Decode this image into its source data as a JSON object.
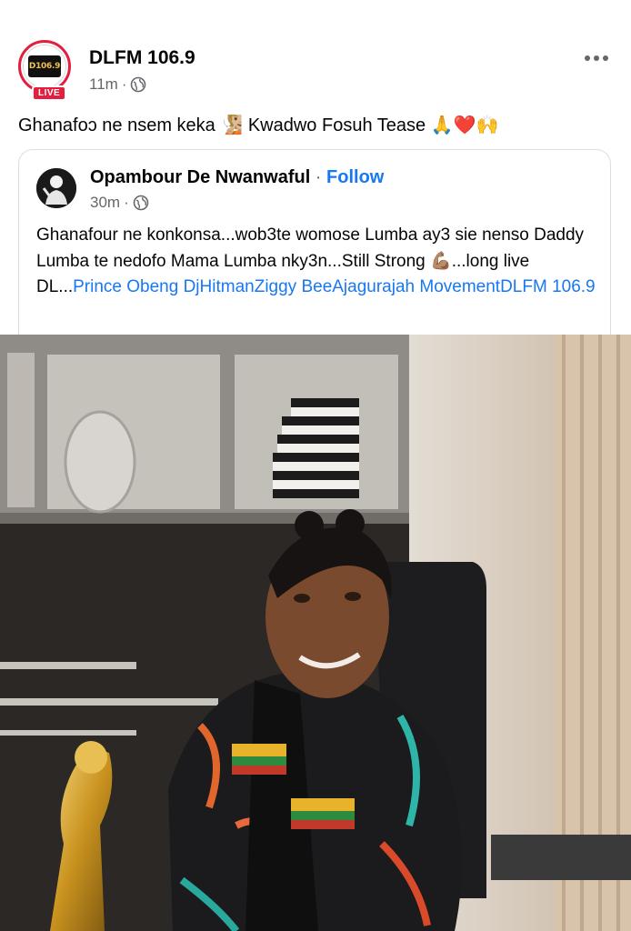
{
  "post": {
    "page_name": "DLFM 106.9",
    "avatar_logo_text": "D106.9",
    "live_badge": "LIVE",
    "time": "11m",
    "separator": "·",
    "more_icon": "more-horizontal-icon",
    "text_part1": "Ghanafoɔ ne nsem keka ",
    "text_part2": " Kwadwo Fosuh Tease ",
    "emojis": {
      "person": "🧏🏼",
      "pray": "🙏",
      "heart": "❤️",
      "raised_hands": "🙌"
    }
  },
  "shared": {
    "author": "Opambour De Nwanwaful",
    "dot": " · ",
    "follow_label": "Follow",
    "time": "30m",
    "separator": "·",
    "text_line1": "Ghanafour ne konkonsa...wob3te womose Lumba ay3 sie nenso Daddy Lumba te nedofo Mama Lumba nky3n...Still Strong ",
    "flex_emoji": "💪🏽",
    "text_after_emoji": "...long live DL...",
    "mentions": [
      "Prince Obeng DjHitmanZiggy BeeAjagurajah Movement",
      "DLFM 106.9"
    ]
  },
  "colors": {
    "link": "#1877f2",
    "live_red": "#e41e3f",
    "meta_gray": "#65676b"
  }
}
